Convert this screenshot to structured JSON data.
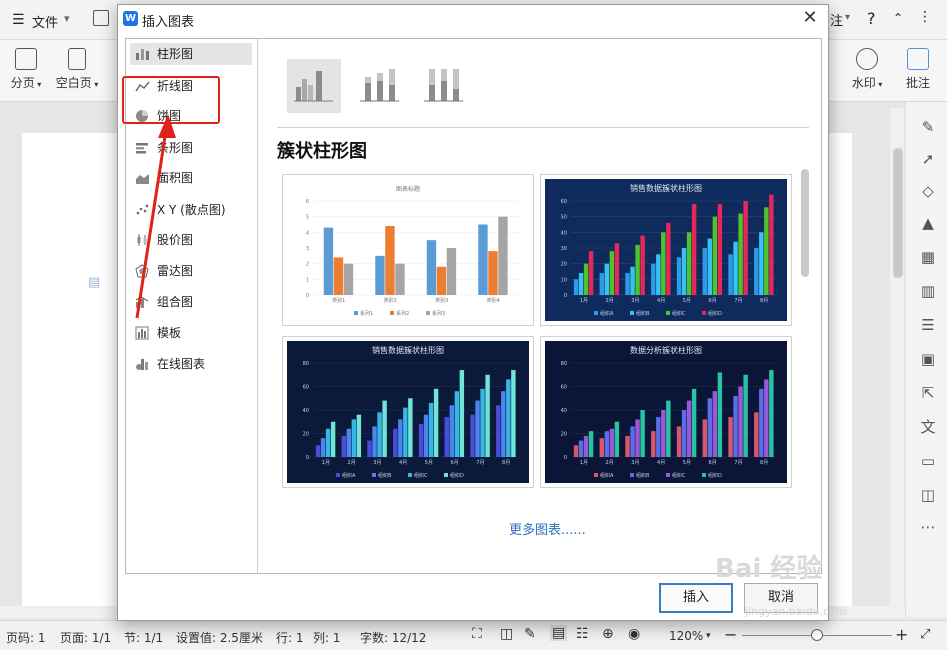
{
  "app": {
    "menu_icon": "hamburger-icon",
    "menu_label": "文件",
    "help_label": "?",
    "right_tab_label": "注",
    "ribbon": {
      "pagebreak": "分页",
      "blankpage": "空白页",
      "watermark": "水印",
      "comment": "批注"
    },
    "status": {
      "page_no": "页码: 1",
      "pages": "页面: 1/1",
      "section": "节: 1/1",
      "setting": "设置值: 2.5厘米",
      "line": "行: 1",
      "col": "列: 1",
      "words": "字数: 12/12",
      "zoom": "120%",
      "zoom_minus": "−",
      "zoom_plus": "+"
    }
  },
  "dialog": {
    "title": "插入图表",
    "close_icon": "close-icon",
    "categories": [
      {
        "label": "柱形图",
        "icon": "bar-chart-icon"
      },
      {
        "label": "折线图",
        "icon": "line-chart-icon"
      },
      {
        "label": "饼图",
        "icon": "pie-chart-icon"
      },
      {
        "label": "条形图",
        "icon": "horizontal-bar-icon"
      },
      {
        "label": "面积图",
        "icon": "area-chart-icon"
      },
      {
        "label": "X Y (散点图)",
        "icon": "scatter-chart-icon"
      },
      {
        "label": "股价图",
        "icon": "stock-chart-icon"
      },
      {
        "label": "雷达图",
        "icon": "radar-chart-icon"
      },
      {
        "label": "组合图",
        "icon": "combo-chart-icon"
      },
      {
        "label": "模板",
        "icon": "template-icon"
      },
      {
        "label": "在线图表",
        "icon": "online-chart-icon"
      }
    ],
    "selected_category": "柱形图",
    "subtype_title": "簇状柱形图",
    "subtypes": [
      "clustered-column-icon",
      "stacked-column-icon",
      "percent-stacked-column-icon"
    ],
    "thumbnails": [
      {
        "title": "图表标题",
        "theme": "light",
        "bg": "#ffffff",
        "categories": [
          "类别1",
          "类别2",
          "类别3",
          "类别4"
        ],
        "series": [
          {
            "name": "系列1",
            "color": "#5b9bd5",
            "values": [
              4.3,
              2.5,
              3.5,
              4.5
            ]
          },
          {
            "name": "系列2",
            "color": "#ed7d31",
            "values": [
              2.4,
              4.4,
              1.8,
              2.8
            ]
          },
          {
            "name": "系列3",
            "color": "#a5a5a5",
            "values": [
              2.0,
              2.0,
              3.0,
              5.0
            ]
          }
        ],
        "ymax": 6,
        "yticks": [
          "0",
          "1",
          "2",
          "3",
          "4",
          "5",
          "6"
        ]
      },
      {
        "title": "销售数据簇状柱形图",
        "theme": "dark",
        "bg": "#0f2a5c",
        "categories": [
          "1月",
          "2月",
          "3月",
          "4月",
          "5月",
          "6月",
          "7月",
          "8月"
        ],
        "series": [
          {
            "name": "组织A",
            "color": "#2e9bea",
            "values": [
              10,
              14,
              14,
              20,
              24,
              30,
              26,
              30
            ]
          },
          {
            "name": "组织B",
            "color": "#37c3f0",
            "values": [
              14,
              20,
              18,
              26,
              30,
              36,
              34,
              40
            ]
          },
          {
            "name": "组织C",
            "color": "#4ec32a",
            "values": [
              20,
              28,
              32,
              40,
              40,
              50,
              52,
              56
            ]
          },
          {
            "name": "组织D",
            "color": "#e4285a",
            "values": [
              28,
              33,
              38,
              46,
              58,
              58,
              60,
              64
            ]
          }
        ],
        "ymax": 60,
        "yticks": [
          "0",
          "10",
          "20",
          "30",
          "40",
          "50",
          "60"
        ]
      },
      {
        "title": "销售数据簇状柱形图",
        "theme": "dark",
        "bg": "#0b1a3a",
        "categories": [
          "1月",
          "2月",
          "3月",
          "4月",
          "5月",
          "6月",
          "7月",
          "8月"
        ],
        "series": [
          {
            "name": "组织A",
            "color": "#4a4ddb",
            "values": [
              10,
              18,
              14,
              24,
              28,
              34,
              36,
              44
            ]
          },
          {
            "name": "组织B",
            "color": "#4b86f0",
            "values": [
              16,
              24,
              26,
              32,
              36,
              44,
              48,
              56
            ]
          },
          {
            "name": "组织C",
            "color": "#36b7e8",
            "values": [
              24,
              32,
              38,
              42,
              46,
              56,
              58,
              66
            ]
          },
          {
            "name": "组织D",
            "color": "#6fe5d8",
            "values": [
              30,
              36,
              48,
              50,
              58,
              74,
              70,
              74
            ]
          }
        ],
        "ymax": 80,
        "yticks": [
          "0",
          "20",
          "40",
          "60",
          "80"
        ]
      },
      {
        "title": "数据分析簇状柱形图",
        "theme": "dark",
        "bg": "#0a1538",
        "categories": [
          "1月",
          "2月",
          "3月",
          "4月",
          "5月",
          "6月",
          "7月",
          "8月"
        ],
        "series": [
          {
            "name": "组织A",
            "color": "#d8576b",
            "values": [
              10,
              16,
              18,
              22,
              26,
              32,
              34,
              38
            ]
          },
          {
            "name": "组织B",
            "color": "#5b6ee8",
            "values": [
              14,
              22,
              26,
              34,
              40,
              50,
              52,
              58
            ]
          },
          {
            "name": "组织C",
            "color": "#9a5ad8",
            "values": [
              18,
              24,
              32,
              40,
              48,
              56,
              60,
              66
            ]
          },
          {
            "name": "组织D",
            "color": "#28c3a0",
            "values": [
              22,
              30,
              40,
              48,
              58,
              72,
              70,
              74
            ]
          }
        ],
        "ymax": 80,
        "yticks": [
          "0",
          "20",
          "40",
          "60",
          "80"
        ]
      }
    ],
    "more_link": "更多图表......",
    "insert_label": "插入",
    "cancel_label": "取消"
  },
  "watermark": {
    "text": "Bai 经验",
    "url": "jingyan.baidu.com"
  },
  "colors": {
    "annotation_red": "#e0231a",
    "accent_blue": "#3c78c8",
    "link_blue": "#2b6fc2"
  }
}
